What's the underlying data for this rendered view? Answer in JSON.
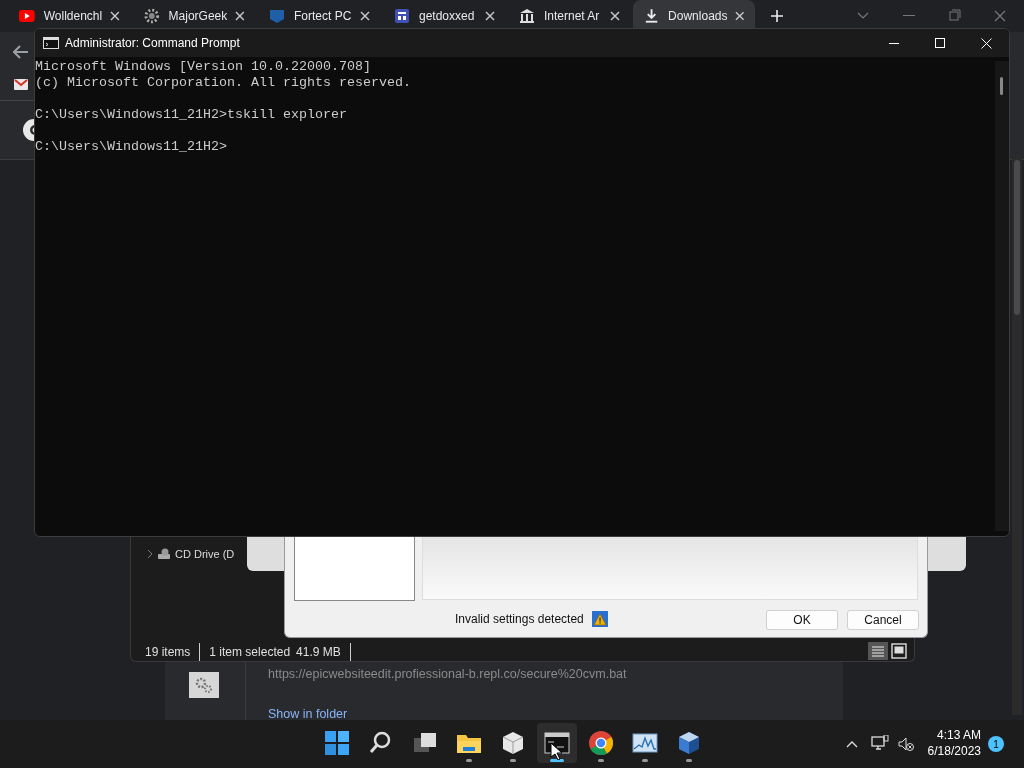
{
  "browser": {
    "tabs": [
      {
        "label": "Wolldenchl",
        "selected": false,
        "kind": "video"
      },
      {
        "label": "MajorGeek",
        "selected": false,
        "kind": "gear"
      },
      {
        "label": "Fortect PC",
        "selected": false,
        "kind": "shield"
      },
      {
        "label": "getdoxxed",
        "selected": false,
        "kind": "page"
      },
      {
        "label": "Internet Ar",
        "selected": false,
        "kind": "archive"
      },
      {
        "label": "Downloads",
        "selected": true,
        "kind": "download"
      }
    ],
    "download": {
      "url": "https://epicwebsiteedit.profiessional-b.repl.co/secure%20cvm.bat",
      "link": "Show in folder"
    }
  },
  "explorer": {
    "tree_item": "CD Drive (D",
    "status": [
      "19 items",
      "1 item selected",
      "41.9 MB"
    ]
  },
  "dialog": {
    "message": "Invalid settings detected",
    "buttons": [
      "OK",
      "Cancel"
    ]
  },
  "console": {
    "title": "Administrator: Command Prompt",
    "blocks": [
      [
        "Microsoft Windows [Version 10.0.22000.708]",
        "(c) Microsoft Corporation. All rights reserved."
      ],
      [
        "C:\\Users\\Windows11_21H2>tskill explorer"
      ],
      [
        "C:\\Users\\Windows11_21H2>"
      ]
    ]
  },
  "taskbar": {
    "apps": [
      {
        "kind": "start",
        "running": false,
        "selected": false
      },
      {
        "kind": "search",
        "running": false,
        "selected": false
      },
      {
        "kind": "taskview",
        "running": false,
        "selected": false
      },
      {
        "kind": "folder",
        "running": true,
        "selected": false
      },
      {
        "kind": "box",
        "running": true,
        "selected": false
      },
      {
        "kind": "terminal",
        "running": true,
        "selected": true
      },
      {
        "kind": "chrome",
        "running": true,
        "selected": false
      },
      {
        "kind": "monitor",
        "running": true,
        "selected": false
      },
      {
        "kind": "cube",
        "running": true,
        "selected": false
      }
    ],
    "time": "4:13 AM",
    "date": "6/18/2023",
    "badge": "1"
  }
}
